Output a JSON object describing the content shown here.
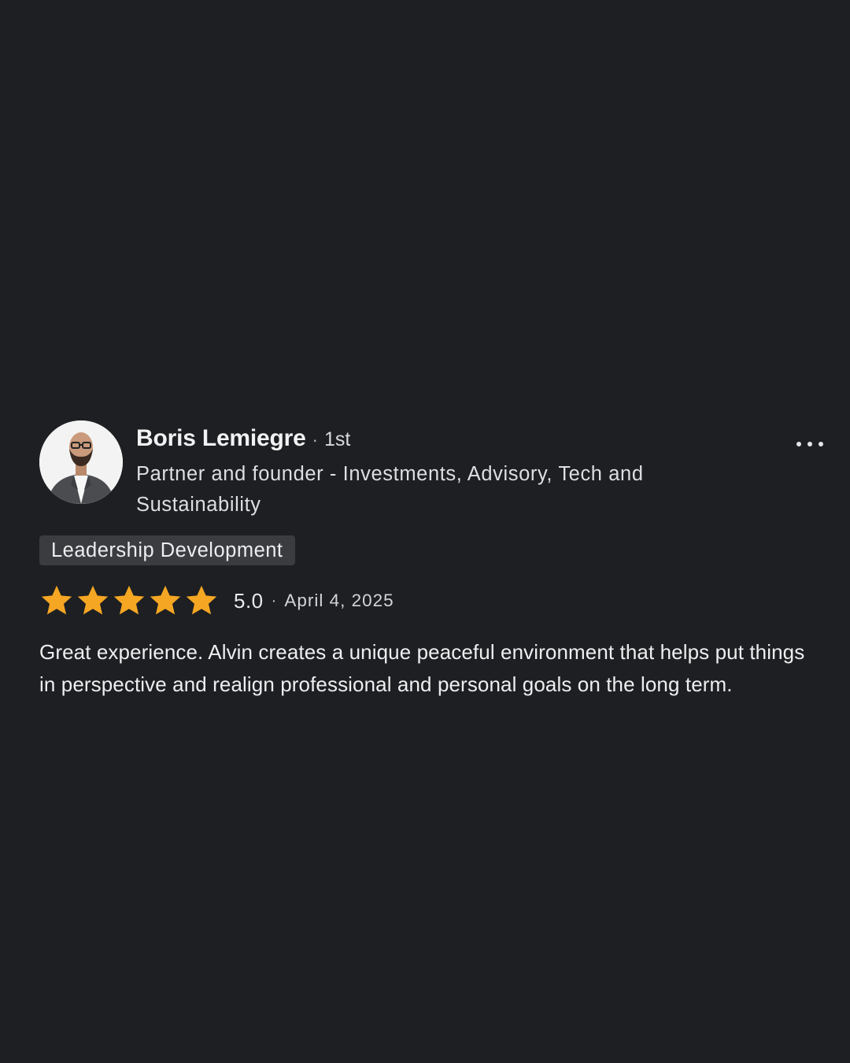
{
  "review": {
    "author": {
      "name": "Boris Lemiegre",
      "separator": "·",
      "connection_degree": "1st",
      "headline": "Partner and founder - Investments, Advisory, Tech and Sustainability",
      "avatar_icon": "person-avatar"
    },
    "more_icon": "ellipsis-icon",
    "service_tag": "Leadership Development",
    "rating": {
      "stars": 5,
      "max_stars": 5,
      "value": "5.0",
      "separator": "·",
      "date": "April 4, 2025",
      "star_color": "#f5a623"
    },
    "text": "Great experience. Alvin creates a unique peaceful environment that helps put things in perspective and realign professional and personal goals on the long term."
  },
  "colors": {
    "background": "#1d1f22",
    "tag_background": "#3a3c40",
    "text_primary": "#eeeeef"
  }
}
